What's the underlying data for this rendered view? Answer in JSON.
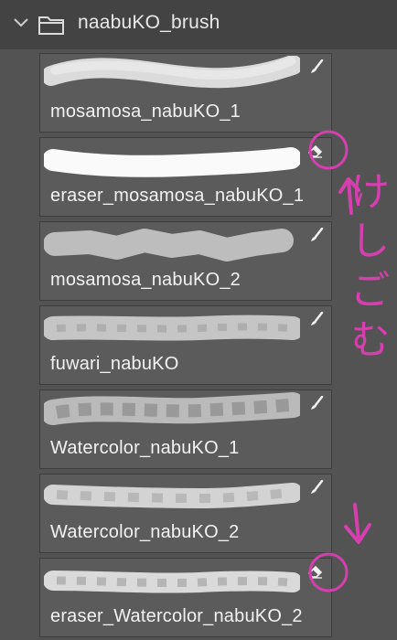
{
  "group": {
    "title": "naabuKO_brush",
    "expanded": true,
    "icon": "folder-icon"
  },
  "brushes": [
    {
      "name": "mosamosa_nabuKO_1",
      "tool": "brush-icon"
    },
    {
      "name": "eraser_mosamosa_nabuKO_1",
      "tool": "eraser-icon"
    },
    {
      "name": "mosamosa_nabuKO_2",
      "tool": "brush-icon"
    },
    {
      "name": "fuwari_nabuKO",
      "tool": "brush-icon"
    },
    {
      "name": "Watercolor_nabuKO_1",
      "tool": "brush-icon"
    },
    {
      "name": "Watercolor_nabuKO_2",
      "tool": "brush-icon"
    },
    {
      "name": "eraser_Watercolor_nabuKO_2",
      "tool": "eraser-icon"
    }
  ],
  "annotation": {
    "text": "けしごむ",
    "color": "#d63fae"
  },
  "colors": {
    "panel": "#535353",
    "header": "#434343",
    "row": "#5b5b5b",
    "annotation": "#d63fae"
  }
}
